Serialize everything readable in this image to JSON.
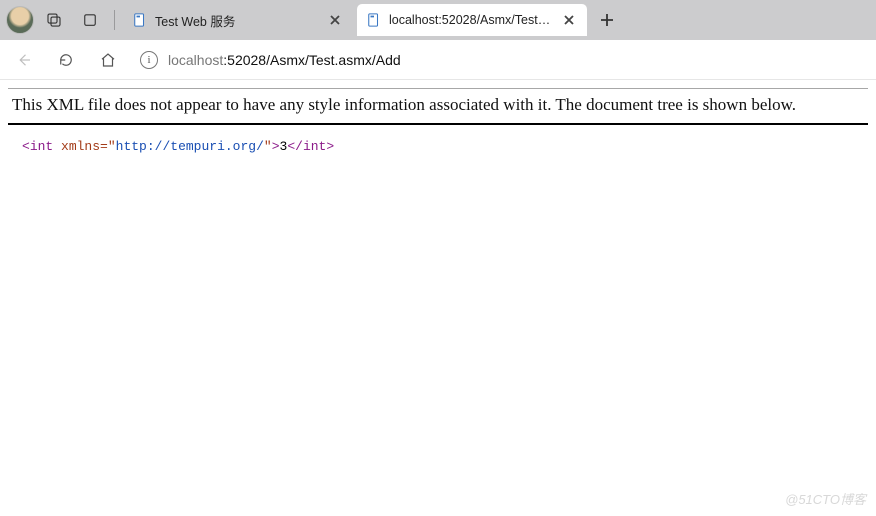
{
  "tabs": {
    "inactive": {
      "title": "Test Web 服务"
    },
    "active": {
      "title": "localhost:52028/Asmx/Test.asmx/"
    }
  },
  "address": {
    "host": "localhost",
    "port_and_path": ":52028/Asmx/Test.asmx/Add"
  },
  "page": {
    "notice": "This XML file does not appear to have any style information associated with it. The document tree is shown below.",
    "xml": {
      "tag": "int",
      "attr_name": "xmlns",
      "attr_value": "http://tempuri.org/",
      "text": "3"
    }
  },
  "watermark": "@51CTO博客"
}
